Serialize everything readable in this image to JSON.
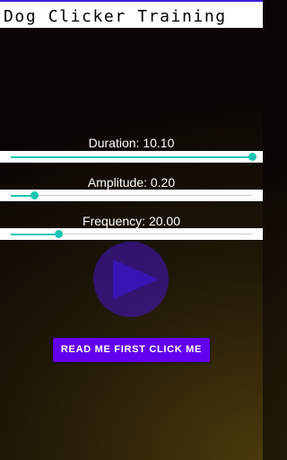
{
  "app": {
    "title": "Dog Clicker Training"
  },
  "sliders": [
    {
      "label": "Duration: 10.10",
      "fraction": 1.0
    },
    {
      "label": "Amplitude: 0.20",
      "fraction": 0.1
    },
    {
      "label": "Frequency: 20.00",
      "fraction": 0.2
    }
  ],
  "actions": {
    "read_me_label": "READ ME FIRST CLICK ME"
  },
  "icons": {
    "play": "play-icon"
  },
  "colors": {
    "accent_line": "#3d21d6",
    "slider_active": "#18c5b5",
    "slider_inactive": "#cfcfcf",
    "play_button": "#4614c8",
    "primary_button": "#6200ee"
  }
}
